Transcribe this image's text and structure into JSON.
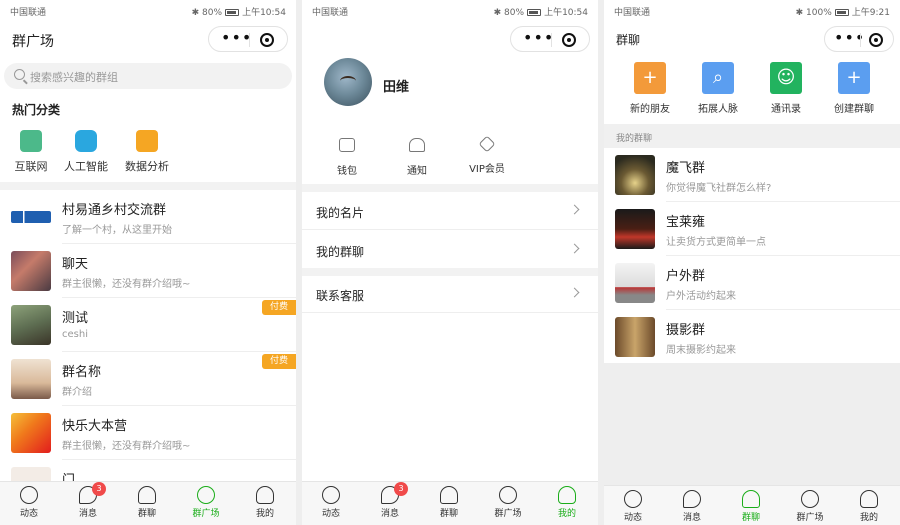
{
  "status_bars": [
    {
      "carrier": "中国联通",
      "battery": "80%",
      "time": "上午10:54"
    },
    {
      "carrier": "中国联通",
      "battery": "80%",
      "time": "上午10:54"
    },
    {
      "carrier": "中国联通",
      "battery": "100%",
      "time": "上午9:21"
    }
  ],
  "capsule": {
    "more_glyph": "•••"
  },
  "screen1": {
    "title": "群广场",
    "search_placeholder": "搜索感兴趣的群组",
    "hot_title": "热门分类",
    "categories": [
      {
        "label": "互联网",
        "color": "#4cb98a"
      },
      {
        "label": "人工智能",
        "color": "#2aa7df"
      },
      {
        "label": "数据分析",
        "color": "#f5a623"
      }
    ],
    "groups": [
      {
        "name": "村易通乡村交流群",
        "desc": "了解一个村，从这里开始",
        "paid": ""
      },
      {
        "name": "聊天",
        "desc": "群主很懒，还没有群介绍哦~",
        "paid": ""
      },
      {
        "name": "测试",
        "desc": "ceshi",
        "paid": "付费"
      },
      {
        "name": "群名称",
        "desc": "群介绍",
        "paid": "付费"
      },
      {
        "name": "快乐大本营",
        "desc": "群主很懒，还没有群介绍哦~",
        "paid": ""
      },
      {
        "name": "门",
        "desc": "",
        "paid": ""
      }
    ]
  },
  "screen2": {
    "username": "田维",
    "quick": [
      {
        "label": "钱包",
        "icon": "wallet-icon"
      },
      {
        "label": "通知",
        "icon": "bell-icon"
      },
      {
        "label": "VIP会员",
        "icon": "diamond-icon"
      }
    ],
    "menu": [
      {
        "label": "我的名片"
      },
      {
        "label": "我的群聊"
      },
      {
        "label": "联系客服"
      }
    ]
  },
  "screen3": {
    "title": "群聊",
    "actions": [
      {
        "label": "新的朋友",
        "color": "#f39a3a",
        "glyph": "+"
      },
      {
        "label": "拓展人脉",
        "color": "#5b9ef0",
        "glyph": "⌕"
      },
      {
        "label": "通讯录",
        "color": "#22b35f",
        "glyph": "☺"
      },
      {
        "label": "创建群聊",
        "color": "#5b9ef0",
        "glyph": "+"
      }
    ],
    "section_label": "我的群聊",
    "groups": [
      {
        "name": "魔飞群",
        "desc": "你觉得魔飞社群怎么样?"
      },
      {
        "name": "宝莱雍",
        "desc": "让卖货方式更简单一点"
      },
      {
        "name": "户外群",
        "desc": "户外活动约起来"
      },
      {
        "name": "摄影群",
        "desc": "周末摄影约起来"
      }
    ]
  },
  "tabs": [
    {
      "label": "动态",
      "icon": "planet-icon"
    },
    {
      "label": "消息",
      "icon": "chat-bubble-icon",
      "badge": "3"
    },
    {
      "label": "群聊",
      "icon": "users-icon"
    },
    {
      "label": "群广场",
      "icon": "compass-icon"
    },
    {
      "label": "我的",
      "icon": "person-icon"
    }
  ],
  "colors": {
    "accent": "#1aad19",
    "paid_badge": "#f5a623",
    "badge": "#f04a4a"
  }
}
